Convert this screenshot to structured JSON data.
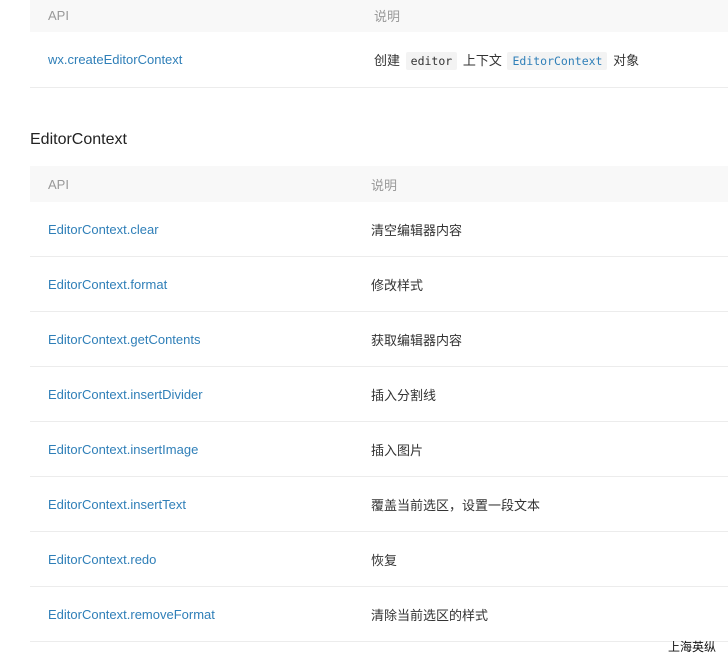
{
  "top_table": {
    "header": {
      "api": "API",
      "desc": "说明"
    },
    "row": {
      "api": "wx.createEditorContext",
      "desc_1": "创建",
      "code_1": "editor",
      "desc_2": "上下文",
      "code_2": "EditorContext",
      "desc_3": "对象"
    }
  },
  "section": {
    "title": "EditorContext"
  },
  "editor_table": {
    "header": {
      "api": "API",
      "desc": "说明"
    },
    "rows": [
      {
        "api": "EditorContext.clear",
        "desc": "清空编辑器内容"
      },
      {
        "api": "EditorContext.format",
        "desc": "修改样式"
      },
      {
        "api": "EditorContext.getContents",
        "desc": "获取编辑器内容"
      },
      {
        "api": "EditorContext.insertDivider",
        "desc": "插入分割线"
      },
      {
        "api": "EditorContext.insertImage",
        "desc": "插入图片"
      },
      {
        "api": "EditorContext.insertText",
        "desc": "覆盖当前选区，设置一段文本"
      },
      {
        "api": "EditorContext.redo",
        "desc": "恢复"
      },
      {
        "api": "EditorContext.removeFormat",
        "desc": "清除当前选区的样式"
      }
    ]
  },
  "watermark": {
    "text": "上海英纵"
  },
  "colors": {
    "link": "#2f7fb8",
    "header_bg": "#f8f8f8",
    "border": "#ececec"
  }
}
